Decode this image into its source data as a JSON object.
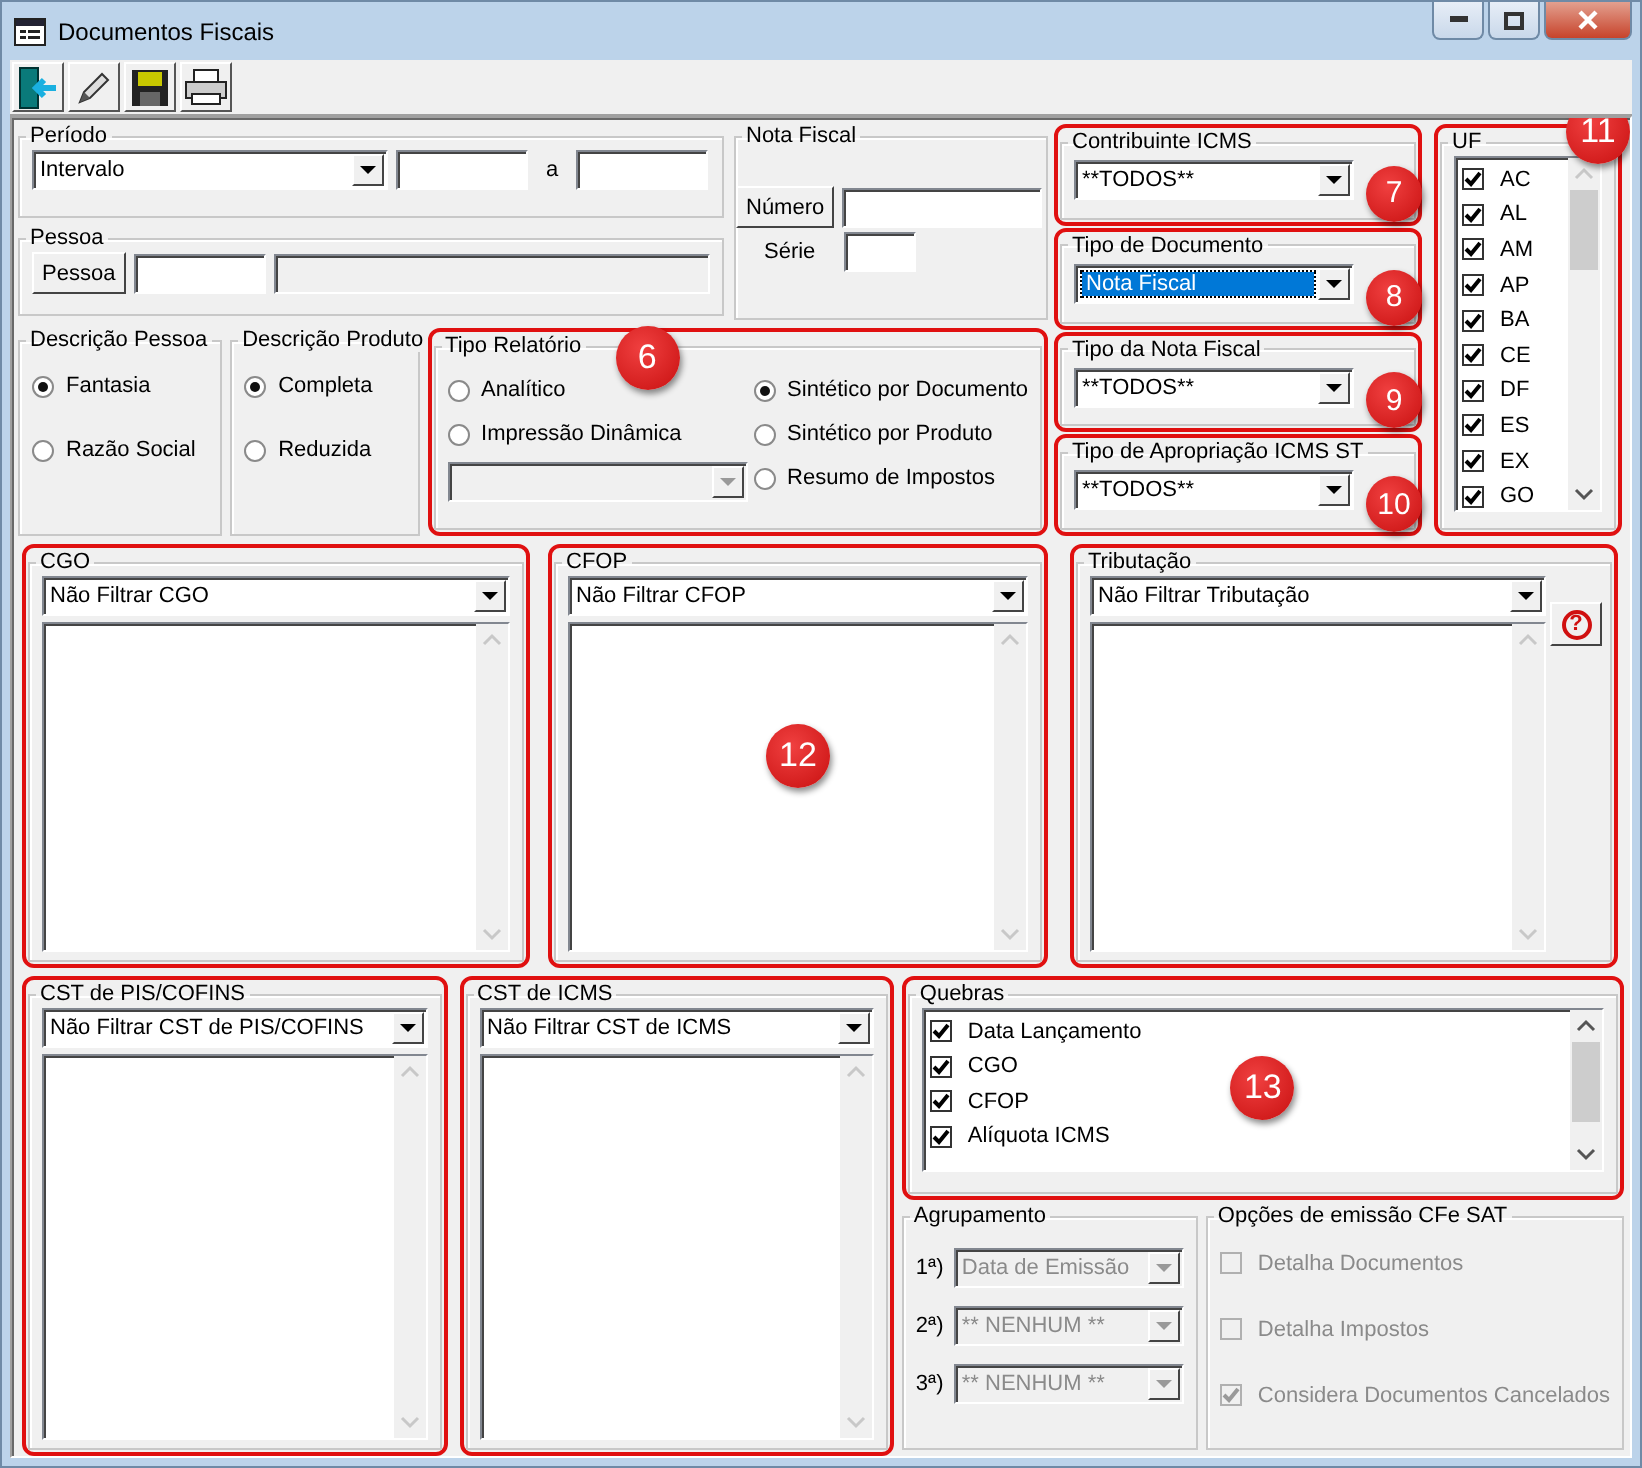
{
  "window": {
    "title": "Documentos Fiscais"
  },
  "periodo": {
    "title": "Período",
    "mode": "Intervalo",
    "to_label": "a"
  },
  "pessoa": {
    "title": "Pessoa",
    "button": "Pessoa"
  },
  "nota_fiscal": {
    "title": "Nota Fiscal",
    "number_button": "Número",
    "series_label": "Série"
  },
  "descricao_pessoa": {
    "title": "Descrição Pessoa",
    "options": [
      {
        "label": "Fantasia",
        "selected": true
      },
      {
        "label": "Razão Social",
        "selected": false
      }
    ]
  },
  "descricao_produto": {
    "title": "Descrição Produto",
    "options": [
      {
        "label": "Completa",
        "selected": true
      },
      {
        "label": "Reduzida",
        "selected": false
      }
    ]
  },
  "tipo_relatorio": {
    "title": "Tipo Relatório",
    "highlighted": true,
    "badge": "6",
    "options": [
      {
        "label": "Analítico",
        "selected": false
      },
      {
        "label": "Impressão Dinâmica",
        "selected": false
      },
      {
        "label": "Sintético por Documento",
        "selected": true
      },
      {
        "label": "Sintético por Produto",
        "selected": false
      },
      {
        "label": "Resumo de Impostos",
        "selected": false
      }
    ]
  },
  "right_filters": [
    {
      "title": "Contribuinte ICMS",
      "value": "**TODOS**",
      "focused": false,
      "highlighted": true,
      "badge": "7"
    },
    {
      "title": "Tipo de Documento",
      "value": "Nota Fiscal",
      "focused": true,
      "highlighted": true,
      "badge": "8"
    },
    {
      "title": "Tipo da Nota Fiscal",
      "value": "**TODOS**",
      "focused": false,
      "highlighted": true,
      "badge": "9"
    },
    {
      "title": "Tipo de Apropriação ICMS ST",
      "value": "**TODOS**",
      "focused": false,
      "highlighted": true,
      "badge": "10"
    }
  ],
  "uf": {
    "title": "UF",
    "highlighted": true,
    "badge": "11",
    "items": [
      {
        "label": "AC",
        "checked": true
      },
      {
        "label": "AL",
        "checked": true
      },
      {
        "label": "AM",
        "checked": true
      },
      {
        "label": "AP",
        "checked": true
      },
      {
        "label": "BA",
        "checked": true
      },
      {
        "label": "CE",
        "checked": true
      },
      {
        "label": "DF",
        "checked": true
      },
      {
        "label": "ES",
        "checked": true
      },
      {
        "label": "EX",
        "checked": true
      },
      {
        "label": "GO",
        "checked": true
      }
    ]
  },
  "filters_upper": [
    {
      "title": "CGO",
      "filter": "Não Filtrar CGO",
      "highlighted": true
    },
    {
      "title": "CFOP",
      "filter": "Não Filtrar CFOP",
      "highlighted": true,
      "badge": "12"
    },
    {
      "title": "Tributação",
      "filter": "Não Filtrar Tributação",
      "highlighted": true,
      "help": "?"
    }
  ],
  "filters_lower": [
    {
      "title": "CST de PIS/COFINS",
      "filter": "Não Filtrar CST de PIS/COFINS",
      "highlighted": true
    },
    {
      "title": "CST de ICMS",
      "filter": "Não Filtrar CST de ICMS",
      "highlighted": true
    }
  ],
  "quebras": {
    "title": "Quebras",
    "highlighted": true,
    "badge": "13",
    "items": [
      {
        "label": "Data Lançamento",
        "checked": true
      },
      {
        "label": "CGO",
        "checked": true
      },
      {
        "label": "CFOP",
        "checked": true
      },
      {
        "label": "Alíquota ICMS",
        "checked": true
      }
    ]
  },
  "agrupamento": {
    "title": "Agrupamento",
    "disabled": true,
    "rows": [
      {
        "label": "1ª)",
        "value": "Data de Emissão"
      },
      {
        "label": "2ª)",
        "value": "** NENHUM **"
      },
      {
        "label": "3ª)",
        "value": "** NENHUM **"
      }
    ]
  },
  "opcoes_cfe_sat": {
    "title": "Opções de emissão CFe SAT",
    "disabled": true,
    "items": [
      {
        "label": "Detalha Documentos",
        "checked": false
      },
      {
        "label": "Detalha Impostos",
        "checked": false
      },
      {
        "label": "Considera Documentos Cancelados",
        "checked": true
      }
    ]
  }
}
